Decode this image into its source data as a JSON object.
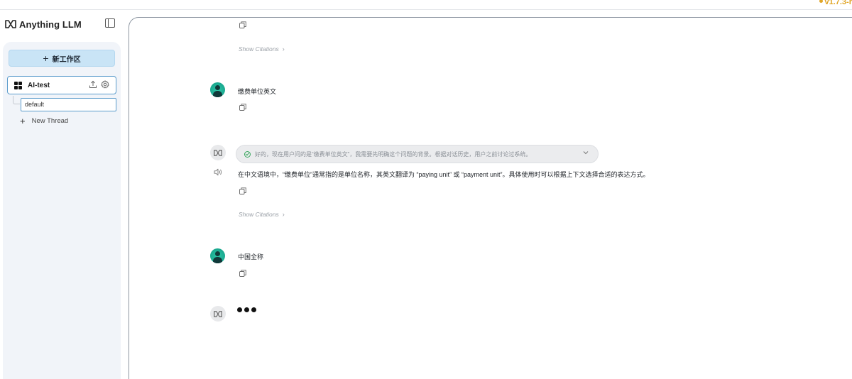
{
  "app": {
    "name": "Anything LLM",
    "version": "v1.7.3-r"
  },
  "sidebar": {
    "new_workspace_label": "新工作区",
    "workspace": {
      "name": "AI-test"
    },
    "threads": [
      {
        "name": "default"
      }
    ],
    "new_thread_label": "New Thread"
  },
  "chat": {
    "show_citations_label": "Show Citations",
    "messages": [
      {
        "role": "user",
        "text": "缴费单位英文"
      },
      {
        "role": "assistant",
        "thought": "好的，现在用户问的是“缴费单位英文”，我需要先明确这个问题的背景。根据对话历史，用户之前讨论过系统。",
        "text": "在中文语境中，“缴费单位”通常指的是单位名称，其英文翻译为 “paying unit” 或 “payment unit”。具体使用时可以根据上下文选择合适的表达方式。"
      },
      {
        "role": "user",
        "text": "中国全称"
      }
    ]
  },
  "colors": {
    "accent": "#5b9ccc",
    "new_button_bg": "#c9e4f6",
    "version": "#e0a526",
    "user_avatar": "#1aa88f"
  }
}
